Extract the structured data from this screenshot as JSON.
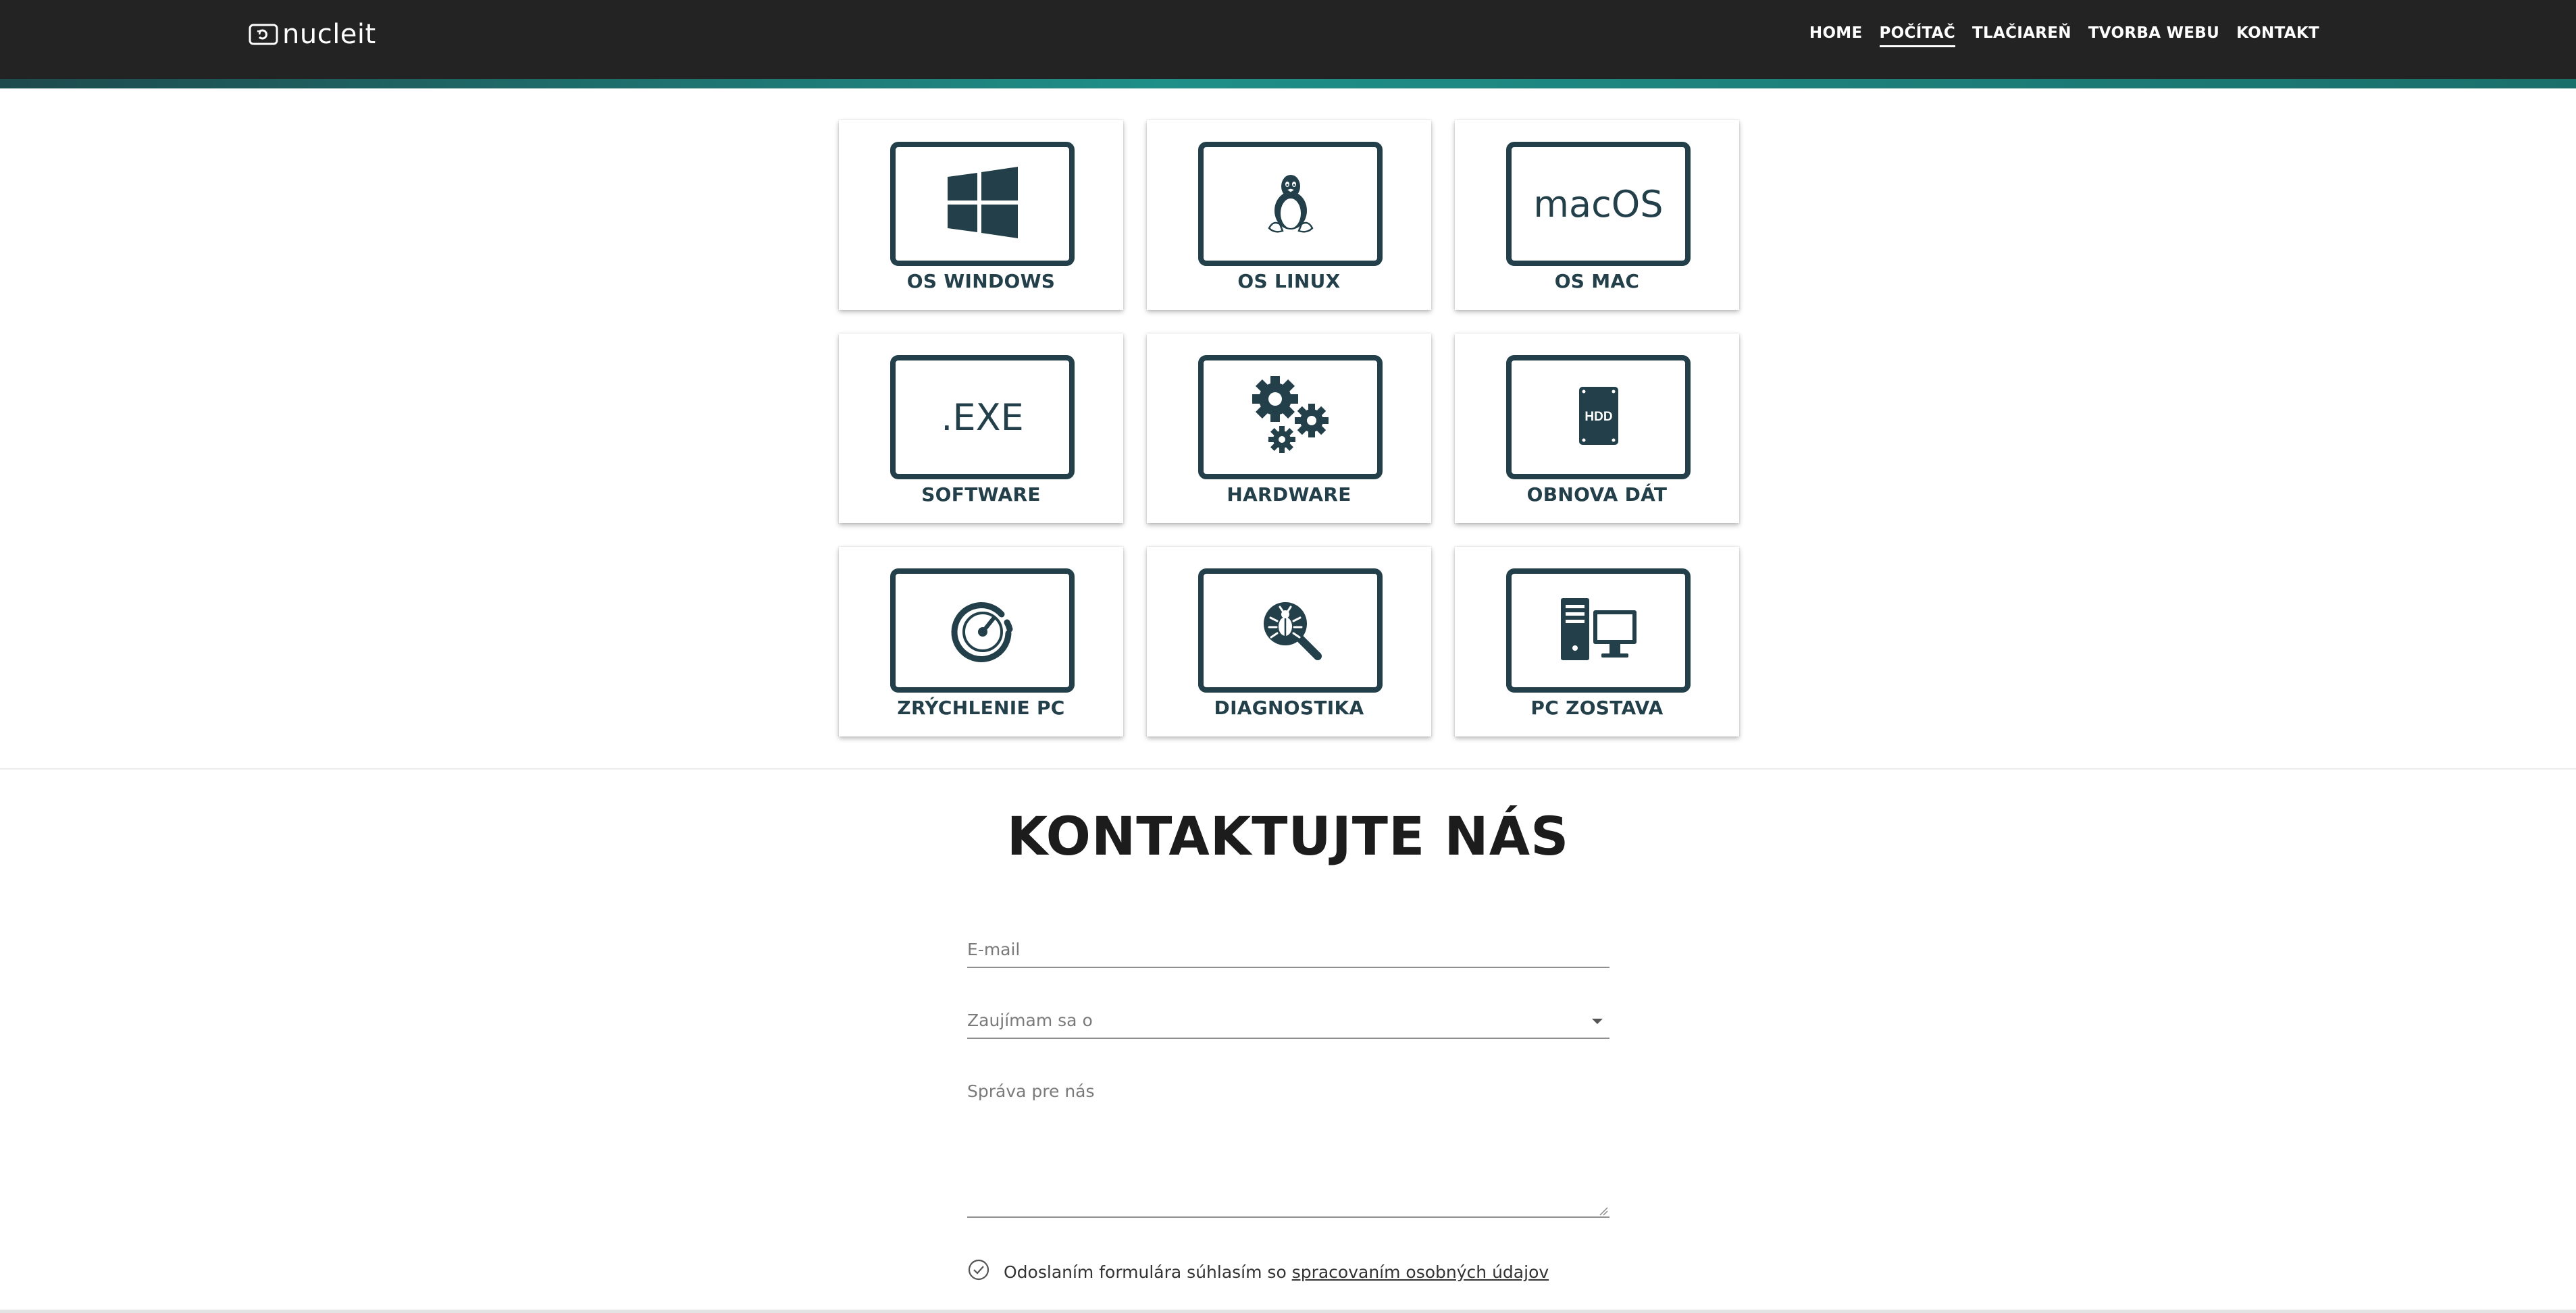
{
  "header": {
    "logo_text": "nucleit",
    "nav": [
      {
        "label": "HOME",
        "active": false
      },
      {
        "label": "POČÍTAČ",
        "active": true
      },
      {
        "label": "TLAČIAREŇ",
        "active": false
      },
      {
        "label": "TVORBA WEBU",
        "active": false
      },
      {
        "label": "KONTAKT",
        "active": false
      }
    ],
    "colors": {
      "bar": "#232323",
      "stripe_accent": "#1f8f88"
    }
  },
  "services": [
    {
      "label": "OS WINDOWS",
      "icon": "windows-logo-icon"
    },
    {
      "label": "OS LINUX",
      "icon": "linux-penguin-icon"
    },
    {
      "label": "OS MAC",
      "icon": "macos-text-icon",
      "icon_text": "macOS"
    },
    {
      "label": "SOFTWARE",
      "icon": "exe-text-icon",
      "icon_text": ".EXE"
    },
    {
      "label": "HARDWARE",
      "icon": "gears-icon"
    },
    {
      "label": "OBNOVA DÁT",
      "icon": "hdd-icon",
      "icon_text": "HDD"
    },
    {
      "label": "ZRÝCHLENIE PC",
      "icon": "speedometer-icon"
    },
    {
      "label": "DIAGNOSTIKA",
      "icon": "bug-magnifier-icon"
    },
    {
      "label": "PC ZOSTAVA",
      "icon": "desktop-pc-icon"
    }
  ],
  "contact": {
    "title": "KONTAKTUJTE NÁS",
    "email_placeholder": "E-mail",
    "interest_placeholder": "Zaujímam sa o",
    "message_placeholder": "Správa pre nás",
    "consent_text": "Odoslaním formulára súhlasím so ",
    "consent_link": "spracovaním osobných údajov"
  },
  "colors": {
    "icon": "#223f4a",
    "accent": "#1f8f88"
  }
}
